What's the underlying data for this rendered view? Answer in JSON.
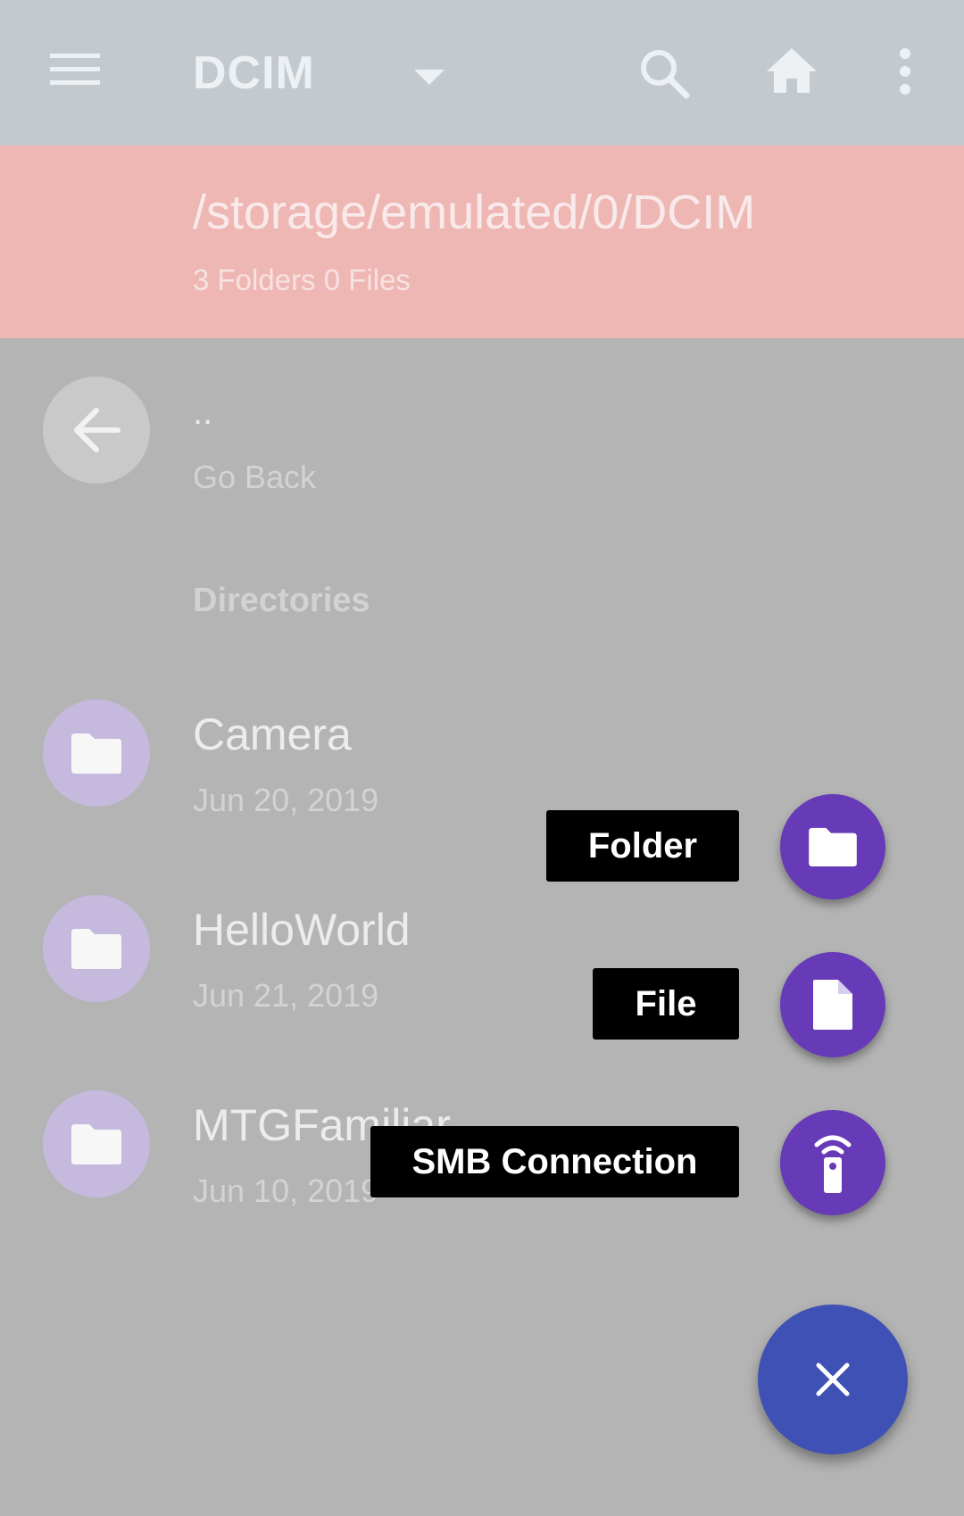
{
  "appbar": {
    "title": "DCIM",
    "icons": [
      "menu-icon",
      "dropdown-arrow-icon",
      "search-icon",
      "home-icon",
      "more-vert-icon"
    ],
    "color": "#c2c9cf"
  },
  "pathbar": {
    "path": "/storage/emulated/0/DCIM",
    "summary": "3 Folders 0 Files",
    "color": "#efb7b4"
  },
  "back_item": {
    "title": "..",
    "subtitle": "Go Back",
    "icon": "arrow-back-icon"
  },
  "section": {
    "directories_label": "Directories"
  },
  "folders": [
    {
      "name": "Camera",
      "date": "Jun 20, 2019",
      "icon": "folder-icon"
    },
    {
      "name": "HelloWorld",
      "date": "Jun 21, 2019",
      "icon": "folder-icon"
    },
    {
      "name": "MTGFamiliar",
      "date": "Jun 10, 2019",
      "icon": "folder-icon"
    }
  ],
  "fab_menu": {
    "items": [
      {
        "label": "Folder",
        "icon": "folder-icon"
      },
      {
        "label": "File",
        "icon": "file-icon"
      },
      {
        "label": "SMB Connection",
        "icon": "remote-icon"
      }
    ],
    "mini_fab_color": "#673ab7",
    "main_fab_color": "#3f51b5",
    "main_fab_icon": "close-icon"
  }
}
